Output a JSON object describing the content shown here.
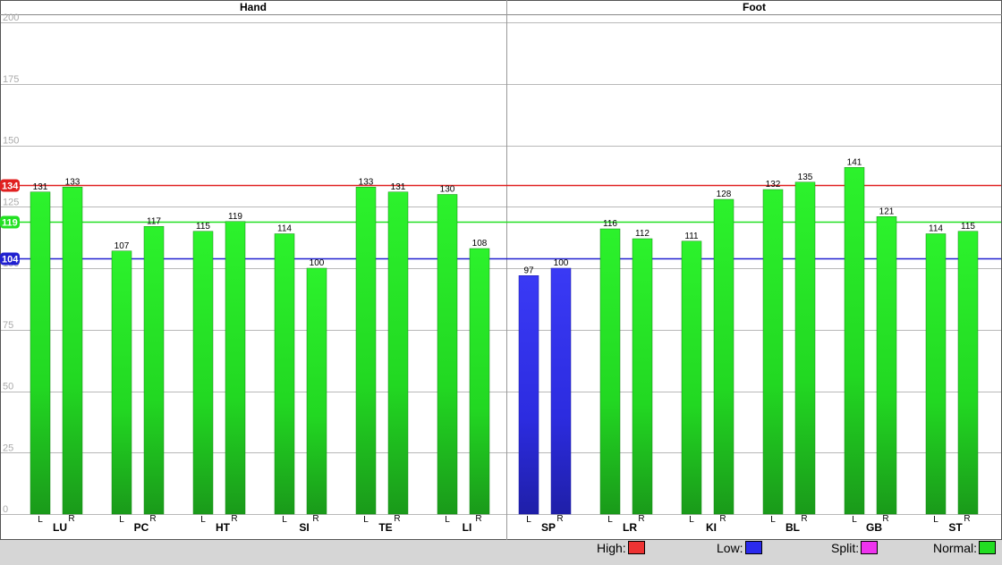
{
  "chart_data": {
    "type": "bar",
    "ylim": [
      0,
      200
    ],
    "yticks": [
      0,
      25,
      50,
      75,
      100,
      125,
      150,
      175,
      200
    ],
    "grid": true,
    "sections": [
      "Hand",
      "Foot"
    ],
    "groups": [
      {
        "name": "LU",
        "section": "Hand",
        "L": 131,
        "R": 133
      },
      {
        "name": "PC",
        "section": "Hand",
        "L": 107,
        "R": 117
      },
      {
        "name": "HT",
        "section": "Hand",
        "L": 115,
        "R": 119
      },
      {
        "name": "SI",
        "section": "Hand",
        "L": 114,
        "R": 100
      },
      {
        "name": "TE",
        "section": "Hand",
        "L": 133,
        "R": 131
      },
      {
        "name": "LI",
        "section": "Hand",
        "L": 130,
        "R": 108
      },
      {
        "name": "SP",
        "section": "Foot",
        "L": 97,
        "R": 100
      },
      {
        "name": "LR",
        "section": "Foot",
        "L": 116,
        "R": 112
      },
      {
        "name": "KI",
        "section": "Foot",
        "L": 111,
        "R": 128
      },
      {
        "name": "BL",
        "section": "Foot",
        "L": 132,
        "R": 135
      },
      {
        "name": "GB",
        "section": "Foot",
        "L": 141,
        "R": 121
      },
      {
        "name": "ST",
        "section": "Foot",
        "L": 114,
        "R": 115
      }
    ],
    "side_labels": [
      "L",
      "R"
    ],
    "thresholds": [
      {
        "name": "High",
        "value": 134,
        "label": "134",
        "color": "#e02020"
      },
      {
        "name": "Normal",
        "value": 119,
        "label": "119",
        "color": "#22e022"
      },
      {
        "name": "Low",
        "value": 104,
        "label": "104",
        "color": "#2020d0"
      }
    ],
    "bar_colors": {
      "normal": "#22ee22",
      "low": "#3030ee"
    },
    "bar_categories": [
      "normal",
      "normal",
      "normal",
      "normal",
      "normal",
      "normal",
      "normal",
      "normal",
      "normal",
      "normal",
      "normal",
      "normal",
      "low",
      "low",
      "normal",
      "normal",
      "normal",
      "normal",
      "normal",
      "normal",
      "normal",
      "normal",
      "normal",
      "normal"
    ]
  },
  "legend": [
    {
      "label": "High:",
      "color": "#ee3333"
    },
    {
      "label": "Low:",
      "color": "#2a2aee"
    },
    {
      "label": "Split:",
      "color": "#ee33ee"
    },
    {
      "label": "Normal:",
      "color": "#22dd22"
    }
  ]
}
